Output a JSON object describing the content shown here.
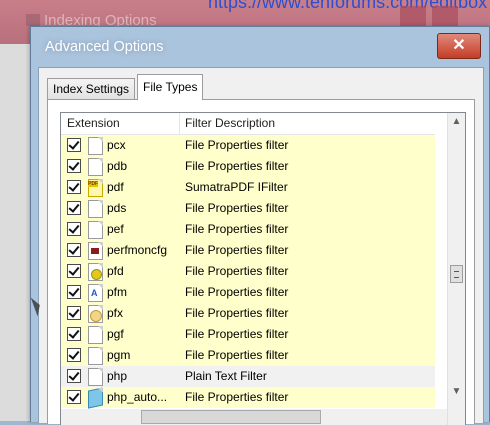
{
  "background_window": {
    "title": "Indexing Options",
    "url_fragment": "https://www.tenforums.com/editbox"
  },
  "dialog": {
    "title": "Advanced Options",
    "close_label": "✕"
  },
  "tabs": [
    {
      "label": "Index Settings",
      "selected": false
    },
    {
      "label": "File Types",
      "selected": true
    }
  ],
  "table": {
    "columns": [
      "Extension",
      "Filter Description"
    ],
    "rows": [
      {
        "ext": "pcx",
        "desc": "File Properties filter",
        "checked": true,
        "icon": "blank-file-icon"
      },
      {
        "ext": "pdb",
        "desc": "File Properties filter",
        "checked": true,
        "icon": "blank-file-icon"
      },
      {
        "ext": "pdf",
        "desc": "SumatraPDF IFilter",
        "checked": true,
        "icon": "pdf-file-icon"
      },
      {
        "ext": "pds",
        "desc": "File Properties filter",
        "checked": true,
        "icon": "blank-file-icon"
      },
      {
        "ext": "pef",
        "desc": "File Properties filter",
        "checked": true,
        "icon": "blank-file-icon"
      },
      {
        "ext": "perfmoncfg",
        "desc": "File Properties filter",
        "checked": true,
        "icon": "perfmon-file-icon"
      },
      {
        "ext": "pfd",
        "desc": "File Properties filter",
        "checked": true,
        "icon": "pfd-file-icon"
      },
      {
        "ext": "pfm",
        "desc": "File Properties filter",
        "checked": true,
        "icon": "font-file-icon"
      },
      {
        "ext": "pfx",
        "desc": "File Properties filter",
        "checked": true,
        "icon": "certificate-file-icon"
      },
      {
        "ext": "pgf",
        "desc": "File Properties filter",
        "checked": true,
        "icon": "blank-file-icon"
      },
      {
        "ext": "pgm",
        "desc": "File Properties filter",
        "checked": true,
        "icon": "blank-file-icon"
      },
      {
        "ext": "php",
        "desc": "Plain Text Filter",
        "checked": true,
        "icon": "blank-file-icon",
        "highlight": true
      },
      {
        "ext": "php_auto...",
        "desc": "File Properties filter",
        "checked": true,
        "icon": "php-auto-file-icon"
      }
    ]
  },
  "colors": {
    "row_bg": "#ffffcc",
    "highlight_row_bg": "#f1f1f1",
    "dialog_frame": "#aac4de",
    "close_button": "#c43c26"
  }
}
